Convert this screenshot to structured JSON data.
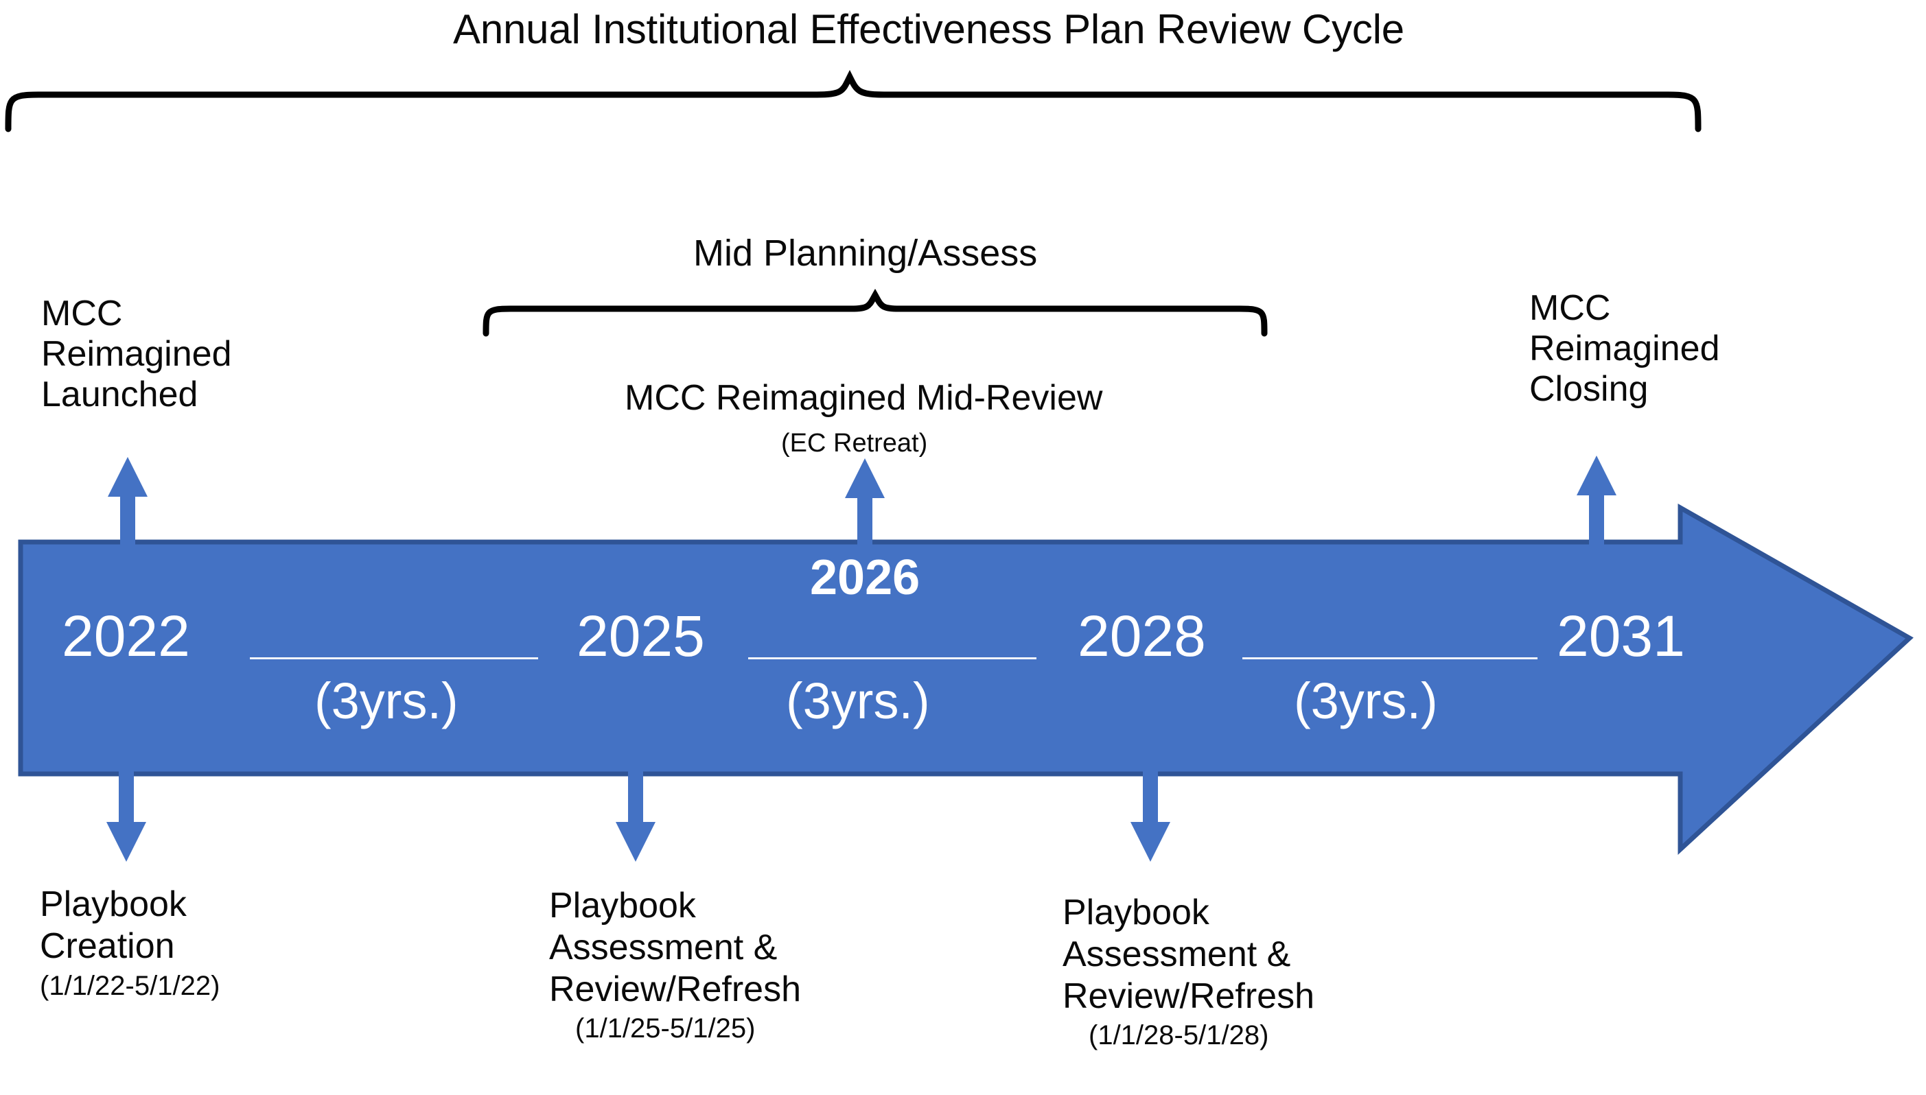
{
  "diagram": {
    "title": "Annual Institutional Effectiveness Plan Review Cycle",
    "mid_bracket_label": "Mid Planning/Assess",
    "colors": {
      "bar_fill": "#4472C4",
      "bar_stroke": "#2F5496",
      "marker_arrow": "#4472C4",
      "bar_text": "#FFFFFF",
      "label_text": "#0A0A0A",
      "separator": "#F2F6FB",
      "background": "#FFFFFF",
      "swirl_teal": "#6FC7B6",
      "swirl_green": "#A8D18D",
      "swirl_blue": "#BDD3E8"
    }
  },
  "top_callouts": {
    "launch": {
      "line1": "MCC",
      "line2": "Reimagined",
      "line3": "Launched"
    },
    "mid_review": {
      "title": "MCC Reimagined Mid-Review",
      "subtitle": "(EC Retreat)"
    },
    "closing": {
      "line1": "MCC",
      "line2": "Reimagined",
      "line3": "Closing"
    }
  },
  "timeline": {
    "milestones": [
      {
        "year": "2022",
        "emphasis": false
      },
      {
        "year": "2025",
        "emphasis": false
      },
      {
        "year": "2026",
        "emphasis": true
      },
      {
        "year": "2028",
        "emphasis": false
      },
      {
        "year": "2031",
        "emphasis": false
      }
    ],
    "intervals": [
      {
        "label": "(3yrs.)"
      },
      {
        "label": "(3yrs.)"
      },
      {
        "label": "(3yrs.)"
      }
    ]
  },
  "bottom_callouts": [
    {
      "line1": "Playbook",
      "line2": "Creation",
      "line3": "",
      "dates": "(1/1/22-5/1/22)"
    },
    {
      "line1": "Playbook",
      "line2": "Assessment &",
      "line3": "Review/Refresh",
      "dates": "(1/1/25-5/1/25)"
    },
    {
      "line1": "Playbook",
      "line2": "Assessment &",
      "line3": "Review/Refresh",
      "dates": "(1/1/28-5/1/28)"
    }
  ]
}
